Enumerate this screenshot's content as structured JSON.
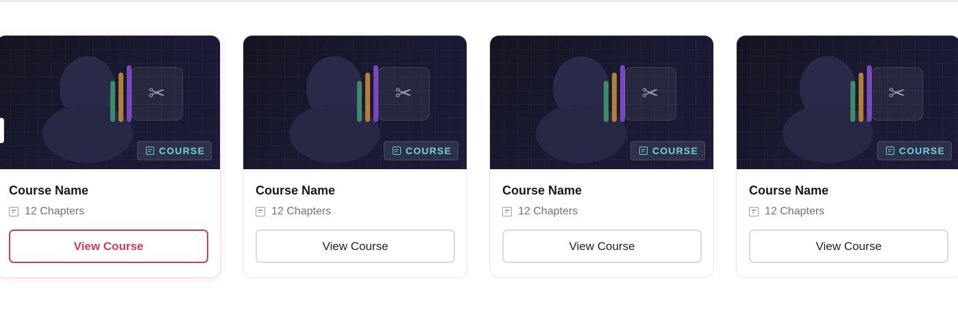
{
  "colors": {
    "accent": "#d23a54",
    "badge_text": "#6fd3dd",
    "thumb_bg": "#1a1a33",
    "stripe_green": "#3f8a6a",
    "stripe_orange": "#b3803a",
    "stripe_purple": "#7a45c2"
  },
  "courses": [
    {
      "badge": "COURSE",
      "badge_icon": "document-icon",
      "title": "Course Name",
      "chapters": "12 Chapters",
      "button": "View Course",
      "state": "active"
    },
    {
      "badge": "COURSE",
      "badge_icon": "document-icon",
      "title": "Course Name",
      "chapters": "12 Chapters",
      "button": "View Course",
      "state": "default"
    },
    {
      "badge": "COURSE",
      "badge_icon": "document-icon",
      "title": "Course Name",
      "chapters": "12 Chapters",
      "button": "View Course",
      "state": "default"
    },
    {
      "badge": "COURSE",
      "badge_icon": "document-icon",
      "title": "Course Name",
      "chapters": "12 Chapters",
      "button": "View Course",
      "state": "default"
    }
  ],
  "thumbnail_icons": {
    "tool": "scissors-icon",
    "person": "person-silhouette-icon"
  }
}
